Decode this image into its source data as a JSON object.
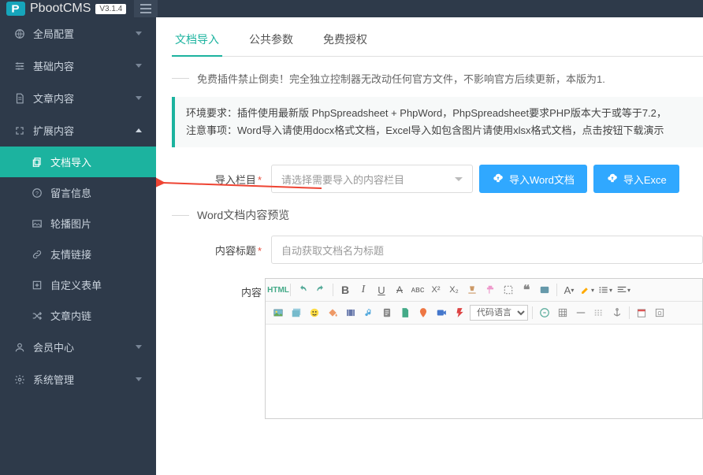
{
  "header": {
    "brand": "PbootCMS",
    "version": "V3.1.4"
  },
  "sidebar": {
    "items": [
      {
        "label": "全局配置"
      },
      {
        "label": "基础内容"
      },
      {
        "label": "文章内容"
      },
      {
        "label": "扩展内容"
      },
      {
        "label": "会员中心"
      },
      {
        "label": "系统管理"
      }
    ],
    "sub": [
      {
        "label": "文档导入"
      },
      {
        "label": "留言信息"
      },
      {
        "label": "轮播图片"
      },
      {
        "label": "友情链接"
      },
      {
        "label": "自定义表单"
      },
      {
        "label": "文章内链"
      }
    ]
  },
  "tabs": [
    "文档导入",
    "公共参数",
    "免费授权"
  ],
  "warning": "免费插件禁止倒卖！完全独立控制器无改动任何官方文件，不影响官方后续更新，本版为1.",
  "greenbox": {
    "line1": "环境要求：插件使用最新版 PhpSpreadsheet + PhpWord，PhpSpreadsheet要求PHP版本大于或等于7.2，",
    "line2": "注意事项：Word导入请使用docx格式文档，Excel导入如包含图片请使用xlsx格式文档，点击按钮下载演示"
  },
  "form": {
    "import_col_label": "导入栏目",
    "select_placeholder": "请选择需要导入的内容栏目",
    "btn_word": "导入Word文档",
    "btn_excel": "导入Exce",
    "preview_title": "Word文档内容预览",
    "title_label": "内容标题",
    "title_placeholder": "自动获取文档名为标题",
    "content_label": "内容",
    "code_lang": "代码语言"
  }
}
